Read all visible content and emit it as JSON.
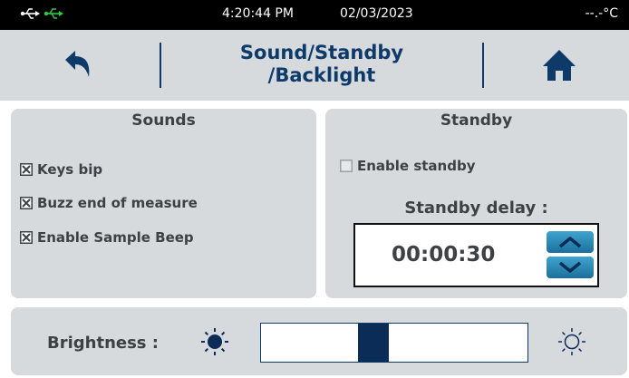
{
  "status": {
    "usb_icons": [
      "usb-icon",
      "usb-connected-icon"
    ],
    "usb_active_color": "#2ecc40",
    "time": "4:20:44 PM",
    "date": "02/03/2023",
    "temperature": "--.-°C"
  },
  "header": {
    "title": "Sound/Standby\n/Backlight",
    "back_icon": "back-arrow-icon",
    "home_icon": "home-icon",
    "accent_color": "#0e3a6a"
  },
  "sounds": {
    "title": "Sounds",
    "options": [
      {
        "label": "Keys bip",
        "checked": true
      },
      {
        "label": "Buzz end of measure",
        "checked": true
      },
      {
        "label": "Enable Sample Beep",
        "checked": true
      }
    ]
  },
  "standby": {
    "title": "Standby",
    "enable_label": "Enable standby",
    "enable_checked": false,
    "delay_label": "Standby delay :",
    "delay_value": "00:00:30",
    "up_icon": "chevron-up-icon",
    "down_icon": "chevron-down-icon"
  },
  "brightness": {
    "label": "Brightness :",
    "level": 0.41,
    "low_icon": "sun-dark-icon",
    "high_icon": "sun-light-icon"
  }
}
